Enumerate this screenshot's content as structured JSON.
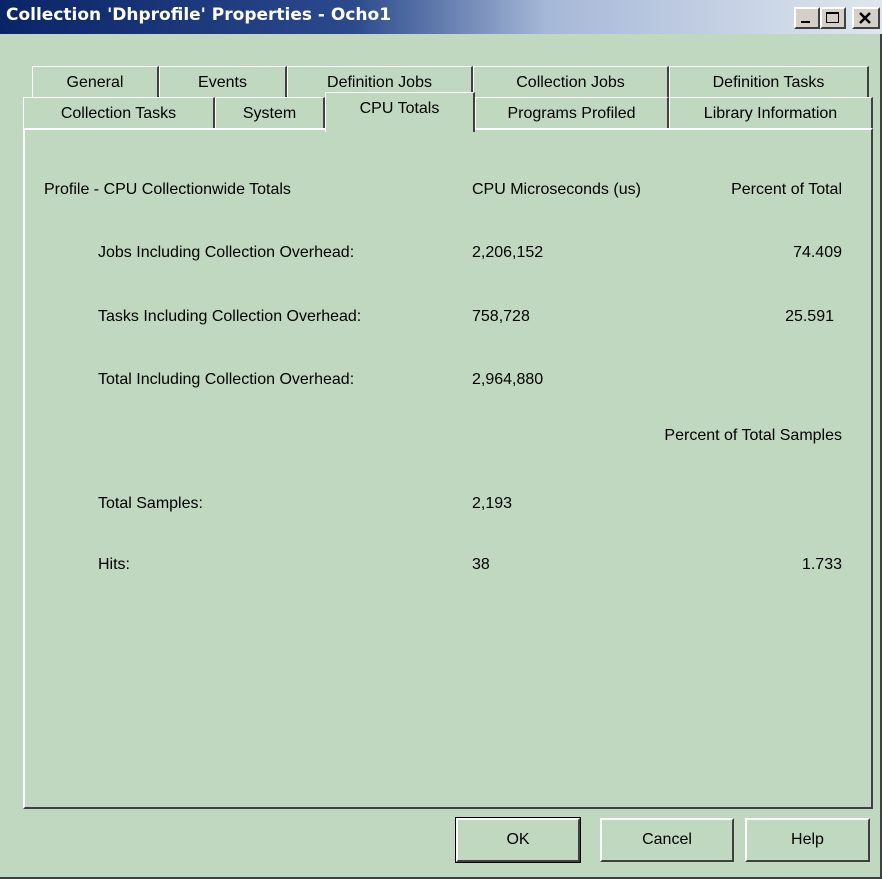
{
  "window": {
    "title": "Collection 'Dhprofile' Properties - Ocho1"
  },
  "tabs": {
    "row_back": [
      "General",
      "Events",
      "Definition Jobs",
      "Collection Jobs",
      "Definition Tasks"
    ],
    "row_front": [
      "Collection Tasks",
      "System",
      "CPU Totals",
      "Programs Profiled",
      "Library Information"
    ],
    "active": "CPU Totals"
  },
  "cpu_totals": {
    "section_header": "Profile - CPU Collectionwide Totals",
    "col_cpu_header": "CPU Microseconds (us)",
    "col_pct_header": "Percent of Total",
    "rows": [
      {
        "label": "Jobs Including Collection Overhead:",
        "cpu": "2,206,152",
        "pct": "74.409"
      },
      {
        "label": "Tasks Including Collection Overhead:",
        "cpu": "758,728",
        "pct": "25.591"
      },
      {
        "label": "Total Including Collection Overhead:",
        "cpu": "2,964,880",
        "pct": ""
      }
    ],
    "samples_header": "Percent of Total Samples",
    "samples": [
      {
        "label": "Total Samples:",
        "value": "2,193",
        "pct": ""
      },
      {
        "label": "Hits:",
        "value": "38",
        "pct": "1.733"
      }
    ]
  },
  "buttons": {
    "ok": "OK",
    "cancel": "Cancel",
    "help": "Help"
  }
}
